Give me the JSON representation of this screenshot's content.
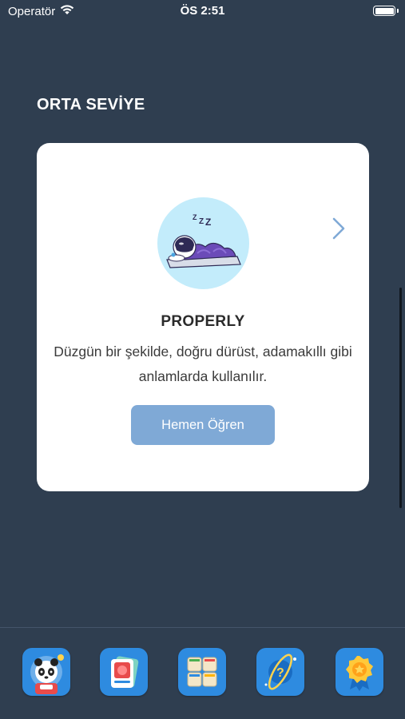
{
  "status_bar": {
    "carrier": "Operatör",
    "time": "ÖS 2:51"
  },
  "section": {
    "title": "ORTA SEVİYE"
  },
  "card": {
    "word": "PROPERLY",
    "meaning": "Düzgün bir şekilde, doğru dürüst, adamakıllı gibi anlamlarda kullanılır.",
    "button_label": "Hemen Öğren",
    "illustration": "sleeping-astronaut-icon",
    "next_icon": "chevron-right-icon",
    "colors": {
      "button": "#7fa9d6",
      "illustration_bg": "#c3ecfb"
    }
  },
  "tab_bar": {
    "items": [
      {
        "icon": "panda-astronaut-icon"
      },
      {
        "icon": "flashcards-icon"
      },
      {
        "icon": "word-blocks-icon"
      },
      {
        "icon": "quiz-planet-icon"
      },
      {
        "icon": "award-badge-icon"
      }
    ]
  },
  "colors": {
    "background": "#2f3e50",
    "card": "#ffffff"
  }
}
